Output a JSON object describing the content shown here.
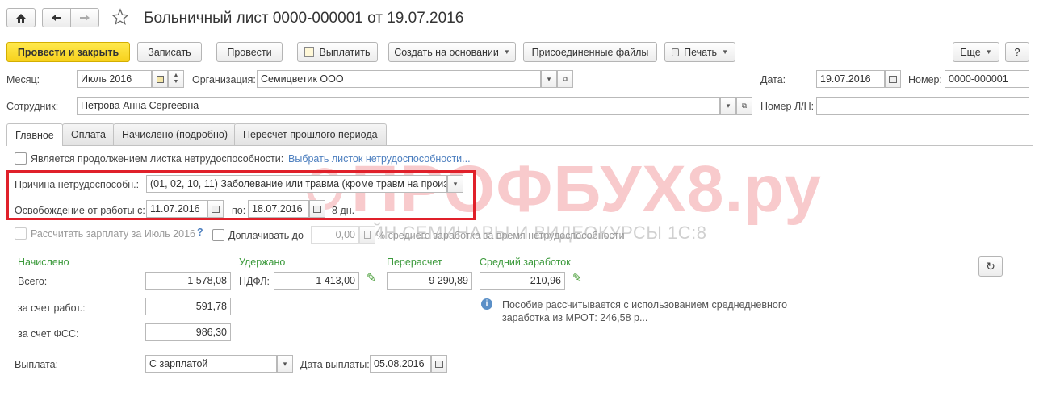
{
  "header": {
    "title": "Больничный лист 0000-000001 от 19.07.2016",
    "home_icon": "home-icon",
    "back_icon": "arrow-left-icon",
    "forward_icon": "arrow-right-icon",
    "star_icon": "star-icon"
  },
  "toolbar": {
    "post_close": "Провести и закрыть",
    "save": "Записать",
    "post": "Провести",
    "pay": "Выплатить",
    "create_based": "Создать на основании",
    "attached_files": "Присоединенные файлы",
    "print": "Печать",
    "more": "Еще",
    "help": "?"
  },
  "fields": {
    "month_label": "Месяц:",
    "month_value": "Июль 2016",
    "org_label": "Организация:",
    "org_value": "Семицветик ООО",
    "date_label": "Дата:",
    "date_value": "19.07.2016",
    "number_label": "Номер:",
    "number_value": "0000-000001",
    "employee_label": "Сотрудник:",
    "employee_value": "Петрова Анна Сергеевна",
    "ln_number_label": "Номер Л/Н:",
    "ln_number_value": ""
  },
  "tabs": [
    {
      "label": "Главное"
    },
    {
      "label": "Оплата"
    },
    {
      "label": "Начислено (подробно)"
    },
    {
      "label": "Пересчет прошлого периода"
    }
  ],
  "main": {
    "continuation_label": "Является продолжением листка нетрудоспособности:",
    "continuation_link": "Выбрать листок нетрудоспособности...",
    "reason_label": "Причина нетрудоспособн.:",
    "reason_value": "(01, 02, 10, 11) Заболевание или травма (кроме травм на произ",
    "release_label": "Освобождение от работы с:",
    "release_from": "11.07.2016",
    "release_to_label": "по:",
    "release_to": "18.07.2016",
    "days": "8 дн.",
    "calc_salary_label": "Рассчитать зарплату за Июль 2016",
    "calc_salary_help": "?",
    "extra_pay_label": "Доплачивать до",
    "extra_pay_value": "0,00",
    "extra_pay_suffix": "% среднего заработка за время нетрудоспособности",
    "watermark": "ПРОФБУХ8.ру",
    "watermark_sub": "ОНЛАЙН СЕМИНАРЫ И ВИДЕОКУРСЫ 1С:8"
  },
  "accrued": {
    "title": "Начислено",
    "total_label": "Всего:",
    "total_value": "1 578,08",
    "employer_label": "за счет работ.:",
    "employer_value": "591,78",
    "fss_label": "за счет ФСС:",
    "fss_value": "986,30"
  },
  "withheld": {
    "title": "Удержано",
    "ndfl_label": "НДФЛ:",
    "ndfl_value": "1 413,00"
  },
  "recalc": {
    "title": "Перерасчет",
    "value": "9 290,89"
  },
  "avg": {
    "title": "Средний заработок",
    "value": "210,96",
    "info": "Пособие рассчитывается с использованием среднедневного заработка из МРОТ: 246,58 р..."
  },
  "payment": {
    "label": "Выплата:",
    "value": "С зарплатой",
    "date_label": "Дата выплаты:",
    "date_value": "05.08.2016"
  },
  "colors": {
    "primary_button": "#f7d11d",
    "highlight_frame": "#e0202a",
    "green_heading": "#3c9a3c",
    "link": "#4d7fbf"
  }
}
